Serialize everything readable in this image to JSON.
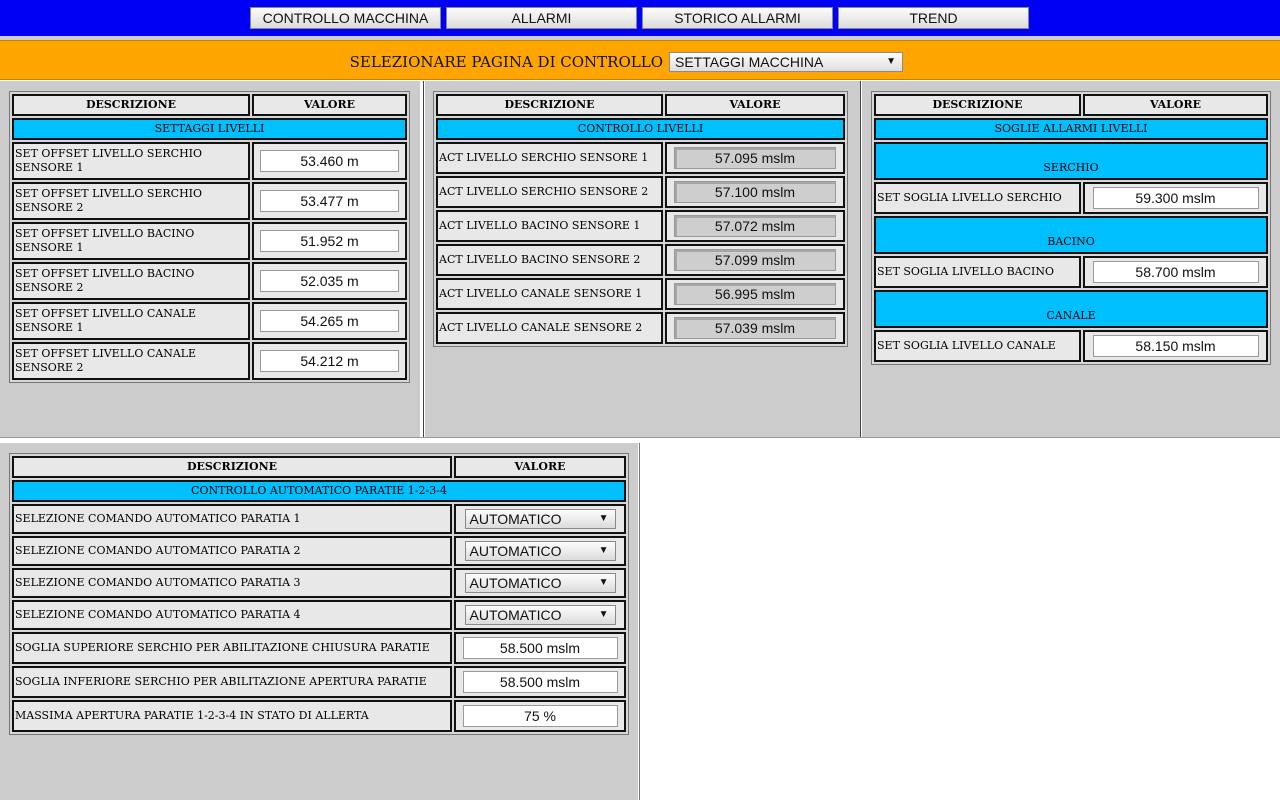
{
  "nav": {
    "buttons": [
      "CONTROLLO MACCHINA",
      "ALLARMI",
      "STORICO ALLARMI",
      "TREND"
    ]
  },
  "page_select": {
    "label": "SELEZIONARE PAGINA DI CONTROLLO",
    "value": "SETTAGGI MACCHINA"
  },
  "headers": {
    "desc": "DESCRIZIONE",
    "value": "VALORE"
  },
  "settaggi": {
    "title": "SETTAGGI LIVELLI",
    "rows": [
      {
        "label": "SET OFFSET LIVELLO SERCHIO SENSORE 1",
        "value": "53.460 m"
      },
      {
        "label": "SET OFFSET LIVELLO SERCHIO SENSORE 2",
        "value": "53.477 m"
      },
      {
        "label": "SET OFFSET LIVELLO BACINO SENSORE 1",
        "value": "51.952 m"
      },
      {
        "label": "SET OFFSET LIVELLO BACINO SENSORE 2",
        "value": "52.035 m"
      },
      {
        "label": "SET OFFSET LIVELLO CANALE SENSORE 1",
        "value": "54.265 m"
      },
      {
        "label": "SET OFFSET LIVELLO CANALE SENSORE 2",
        "value": "54.212 m"
      }
    ]
  },
  "controllo": {
    "title": "CONTROLLO LIVELLI",
    "rows": [
      {
        "label": "ACT LIVELLO SERCHIO SENSORE 1",
        "value": "57.095 mslm"
      },
      {
        "label": "ACT LIVELLO SERCHIO SENSORE 2",
        "value": "57.100 mslm"
      },
      {
        "label": "ACT LIVELLO BACINO SENSORE 1",
        "value": "57.072 mslm"
      },
      {
        "label": "ACT LIVELLO BACINO SENSORE 2",
        "value": "57.099 mslm"
      },
      {
        "label": "ACT LIVELLO CANALE SENSORE 1",
        "value": "56.995 mslm"
      },
      {
        "label": "ACT LIVELLO CANALE SENSORE 2",
        "value": "57.039 mslm"
      }
    ]
  },
  "soglie": {
    "title": "SOGLIE ALLARMI LIVELLI",
    "groups": [
      {
        "name": "SERCHIO",
        "label": "SET SOGLIA LIVELLO SERCHIO",
        "value": "59.300 mslm"
      },
      {
        "name": "BACINO",
        "label": "SET SOGLIA LIVELLO BACINO",
        "value": "58.700 mslm"
      },
      {
        "name": "CANALE",
        "label": "SET SOGLIA LIVELLO CANALE",
        "value": "58.150 mslm"
      }
    ]
  },
  "paratie": {
    "title": "CONTROLLO AUTOMATICO PARATIE 1-2-3-4",
    "selects": [
      {
        "label": "SELEZIONE COMANDO AUTOMATICO PARATIA 1",
        "value": "AUTOMATICO"
      },
      {
        "label": "SELEZIONE COMANDO AUTOMATICO PARATIA 2",
        "value": "AUTOMATICO"
      },
      {
        "label": "SELEZIONE COMANDO AUTOMATICO PARATIA 3",
        "value": "AUTOMATICO"
      },
      {
        "label": "SELEZIONE COMANDO AUTOMATICO PARATIA 4",
        "value": "AUTOMATICO"
      }
    ],
    "inputs": [
      {
        "label": "SOGLIA SUPERIORE SERCHIO PER ABILITAZIONE CHIUSURA PARATIE",
        "value": "58.500 mslm"
      },
      {
        "label": "SOGLIA INFERIORE SERCHIO PER ABILITAZIONE APERTURA PARATIE",
        "value": "58.500 mslm"
      },
      {
        "label": "MASSIMA APERTURA PARATIE 1-2-3-4 IN STATO DI ALLERTA",
        "value": "75 %"
      }
    ]
  },
  "icons": {
    "dropdown": "chevron-down-icon"
  },
  "colors": {
    "nav_bg": "#0000f5",
    "select_bar_bg": "#ffa500",
    "section_bg": "#00bfff",
    "pane_bg": "#cccccc"
  }
}
